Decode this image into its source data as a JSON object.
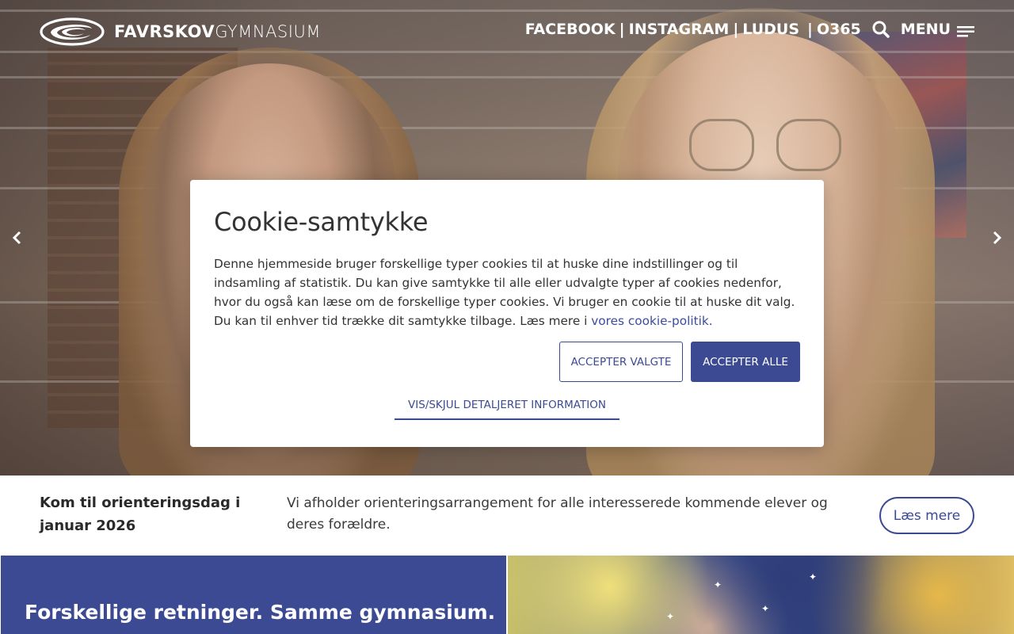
{
  "header": {
    "logo_bold": "FAVRSKOV",
    "logo_light": "GYMNASIUM",
    "nav": [
      {
        "label": "FACEBOOK"
      },
      {
        "label": "INSTAGRAM"
      },
      {
        "label": "LUDUS"
      },
      {
        "label": "O365"
      }
    ],
    "separator": "|",
    "menu_label": "MENU"
  },
  "cookie": {
    "title": "Cookie-samtykke",
    "body": "Denne hjemmeside bruger forskellige typer cookies til at huske dine indstillinger og til indsamling af statistik. Du kan give samtykke til alle eller udvalgte typer af cookies nedenfor, hvor du også kan læse om de forskellige typer cookies. Vi bruger en cookie til at huske dit valg. Du kan til enhver tid trække dit samtykke tilbage. Læs mere i ",
    "link_text": "vores cookie-politik",
    "link_suffix": ".",
    "accept_selected": "ACCEPTER VALGTE",
    "accept_all": "ACCEPTER ALLE",
    "toggle_details": "VIS/SKJUL DETALJERET INFORMATION"
  },
  "infobar": {
    "title": "Kom til orienteringsdag i januar 2026",
    "description": "Vi afholder orienteringsarrangement for alle interesserede kommende elever og deres forældre.",
    "button": "Læs mere"
  },
  "promo": {
    "heading": "Forskellige retninger. Samme gymnasium."
  },
  "colors": {
    "brand": "#3c4a94",
    "text": "#333333"
  },
  "icons": {
    "search": "search-icon",
    "menu": "hamburger-icon",
    "prev": "chevron-left-icon",
    "next": "chevron-right-icon"
  }
}
